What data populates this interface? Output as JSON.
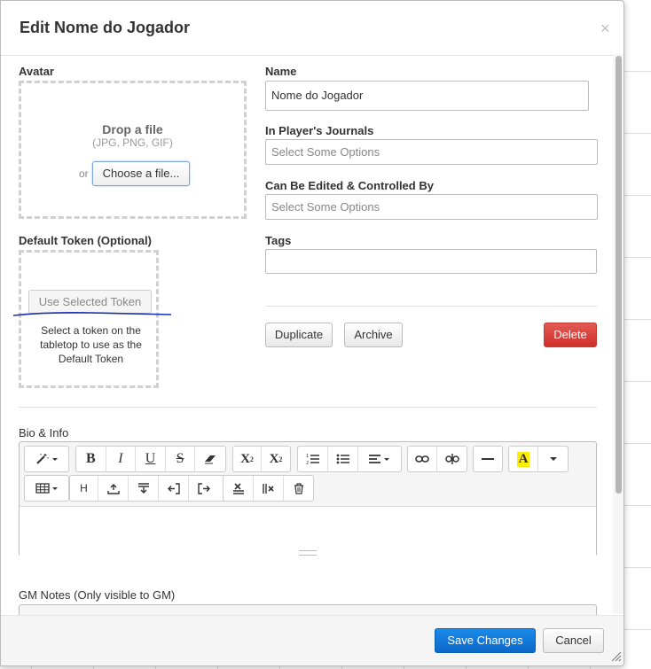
{
  "dialog": {
    "title": "Edit Nome do Jogador",
    "close_glyph": "×"
  },
  "avatar": {
    "label": "Avatar",
    "drop_title": "Drop a file",
    "drop_sub": "(JPG, PNG, GIF)",
    "or_text": "or",
    "choose_label": "Choose a file..."
  },
  "token": {
    "label": "Default Token (Optional)",
    "use_label": "Use Selected Token",
    "help_text": "Select a token on the tabletop to use as the Default Token"
  },
  "form": {
    "name_label": "Name",
    "name_value": "Nome do Jogador",
    "journals_label": "In Player's Journals",
    "journals_placeholder": "Select Some Options",
    "controlled_label": "Can Be Edited & Controlled By",
    "controlled_placeholder": "Select Some Options",
    "tags_label": "Tags",
    "tags_value": ""
  },
  "actions": {
    "duplicate_label": "Duplicate",
    "archive_label": "Archive",
    "delete_label": "Delete"
  },
  "bio": {
    "label": "Bio & Info"
  },
  "gm_notes": {
    "label": "GM Notes (Only visible to GM)"
  },
  "footer": {
    "save_label": "Save Changes",
    "cancel_label": "Cancel"
  },
  "toolbar_row1": [
    {
      "icon": "magic-wand-icon",
      "glyph": "✦▾",
      "interactable": true
    },
    {
      "icon": "bold-icon",
      "glyph": "B"
    },
    {
      "icon": "italic-icon",
      "glyph": "I"
    },
    {
      "icon": "underline-icon",
      "glyph": "U"
    },
    {
      "icon": "strikethrough-icon",
      "glyph": "S"
    },
    {
      "icon": "eraser-icon",
      "glyph": "⌫"
    },
    {
      "icon": "superscript-icon",
      "glyph": "X²"
    },
    {
      "icon": "subscript-icon",
      "glyph": "X₂"
    },
    {
      "icon": "ordered-list-icon",
      "glyph": "≡"
    },
    {
      "icon": "unordered-list-icon",
      "glyph": "☰"
    },
    {
      "icon": "align-icon",
      "glyph": "≡▾"
    },
    {
      "icon": "link-icon",
      "glyph": "∞"
    },
    {
      "icon": "unlink-icon",
      "glyph": "⊘"
    },
    {
      "icon": "horizontal-rule-icon",
      "glyph": "—"
    },
    {
      "icon": "text-color-icon",
      "glyph": "A"
    },
    {
      "icon": "color-dropdown-icon",
      "glyph": "▾"
    }
  ],
  "toolbar_row2": [
    {
      "icon": "table-icon",
      "glyph": "▦▾"
    },
    {
      "icon": "heading-icon",
      "glyph": "H"
    },
    {
      "icon": "row-above-icon",
      "glyph": "⤒"
    },
    {
      "icon": "row-below-icon",
      "glyph": "⤓"
    },
    {
      "icon": "col-left-icon",
      "glyph": "⇤"
    },
    {
      "icon": "col-right-icon",
      "glyph": "⇥"
    },
    {
      "icon": "delete-row-icon",
      "glyph": "✕"
    },
    {
      "icon": "delete-col-icon",
      "glyph": "⊠"
    },
    {
      "icon": "trash-icon",
      "glyph": "🗑"
    }
  ],
  "colors": {
    "primary": "#0a68c9",
    "danger": "#cf2f2a",
    "highlight": "#ffee00"
  }
}
